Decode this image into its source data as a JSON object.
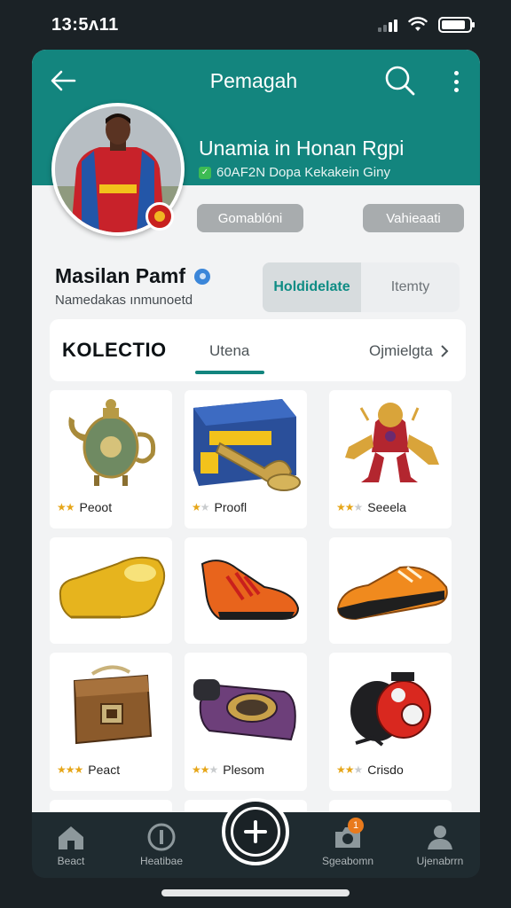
{
  "status_bar": {
    "time": "13:5ᴧ11",
    "battery_level": 0.85,
    "signal_bars": 2
  },
  "header": {
    "title": "Pemagah",
    "hero_title": "Unamia in Honan Rgpi",
    "hero_subtitle": "60AF2N Dopa Kekakein Giny",
    "button_left": "Gomablóni",
    "button_right": "Vahieaati"
  },
  "profile": {
    "name": "Masilan Pamf",
    "subtitle": "Namedakas ınmunoetd"
  },
  "segment": {
    "active": "Holdidelate",
    "inactive": "Itemty"
  },
  "tabs": {
    "title": "KOLECTIO",
    "middle": "Utena",
    "right": "Ojmielgta"
  },
  "items": [
    {
      "label": "Peoot",
      "icon": "teapot-icon",
      "stars": 2
    },
    {
      "label": "Proofl",
      "icon": "trumpet-box-icon",
      "stars": 2
    },
    {
      "label": "Seeela",
      "icon": "robot-figure-icon",
      "stars": 3
    },
    {
      "label": "",
      "icon": "yellow-shoe-icon",
      "stars": 0
    },
    {
      "label": "",
      "icon": "orange-sneaker-icon",
      "stars": 0
    },
    {
      "label": "",
      "icon": "orange-shoe-icon",
      "stars": 0
    },
    {
      "label": "Peact",
      "icon": "chest-icon",
      "stars": 3
    },
    {
      "label": "Plesom",
      "icon": "purple-device-icon",
      "stars": 2
    },
    {
      "label": "Crisdo",
      "icon": "red-engine-icon",
      "stars": 3
    }
  ],
  "bottom_nav": {
    "home": "Beact",
    "info": "Heatibae",
    "camera": "Sgeabomn",
    "profile": "Ujenabrrn",
    "camera_badge": "1"
  },
  "colors": {
    "accent": "#13857e",
    "background": "#1b2226"
  }
}
